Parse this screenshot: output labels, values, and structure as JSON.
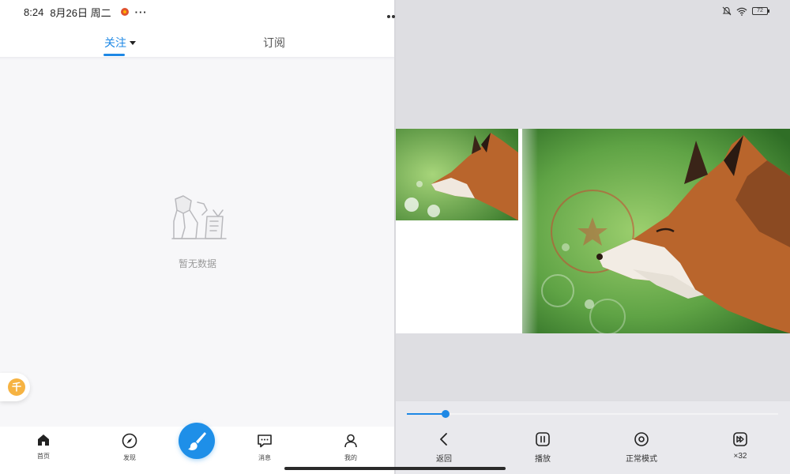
{
  "status_bar": {
    "time": "8:24",
    "date": "8月26日 周二",
    "more": "···",
    "battery": "72"
  },
  "tabs": {
    "follow": "关注",
    "subscribe": "订阅"
  },
  "empty_state": {
    "text": "暂无数据"
  },
  "floating": {
    "coin_glyph": "千"
  },
  "bottom_nav": {
    "home": "首页",
    "discover": "发现",
    "message": "消息",
    "mine": "我的"
  },
  "player": {
    "progress": 0.105,
    "back": "返回",
    "play": "播放",
    "mode": "正常模式",
    "speed": "×32"
  },
  "colors": {
    "accent": "#1e88e5",
    "fab": "#1e8fe8",
    "coin": "#f6b342"
  }
}
